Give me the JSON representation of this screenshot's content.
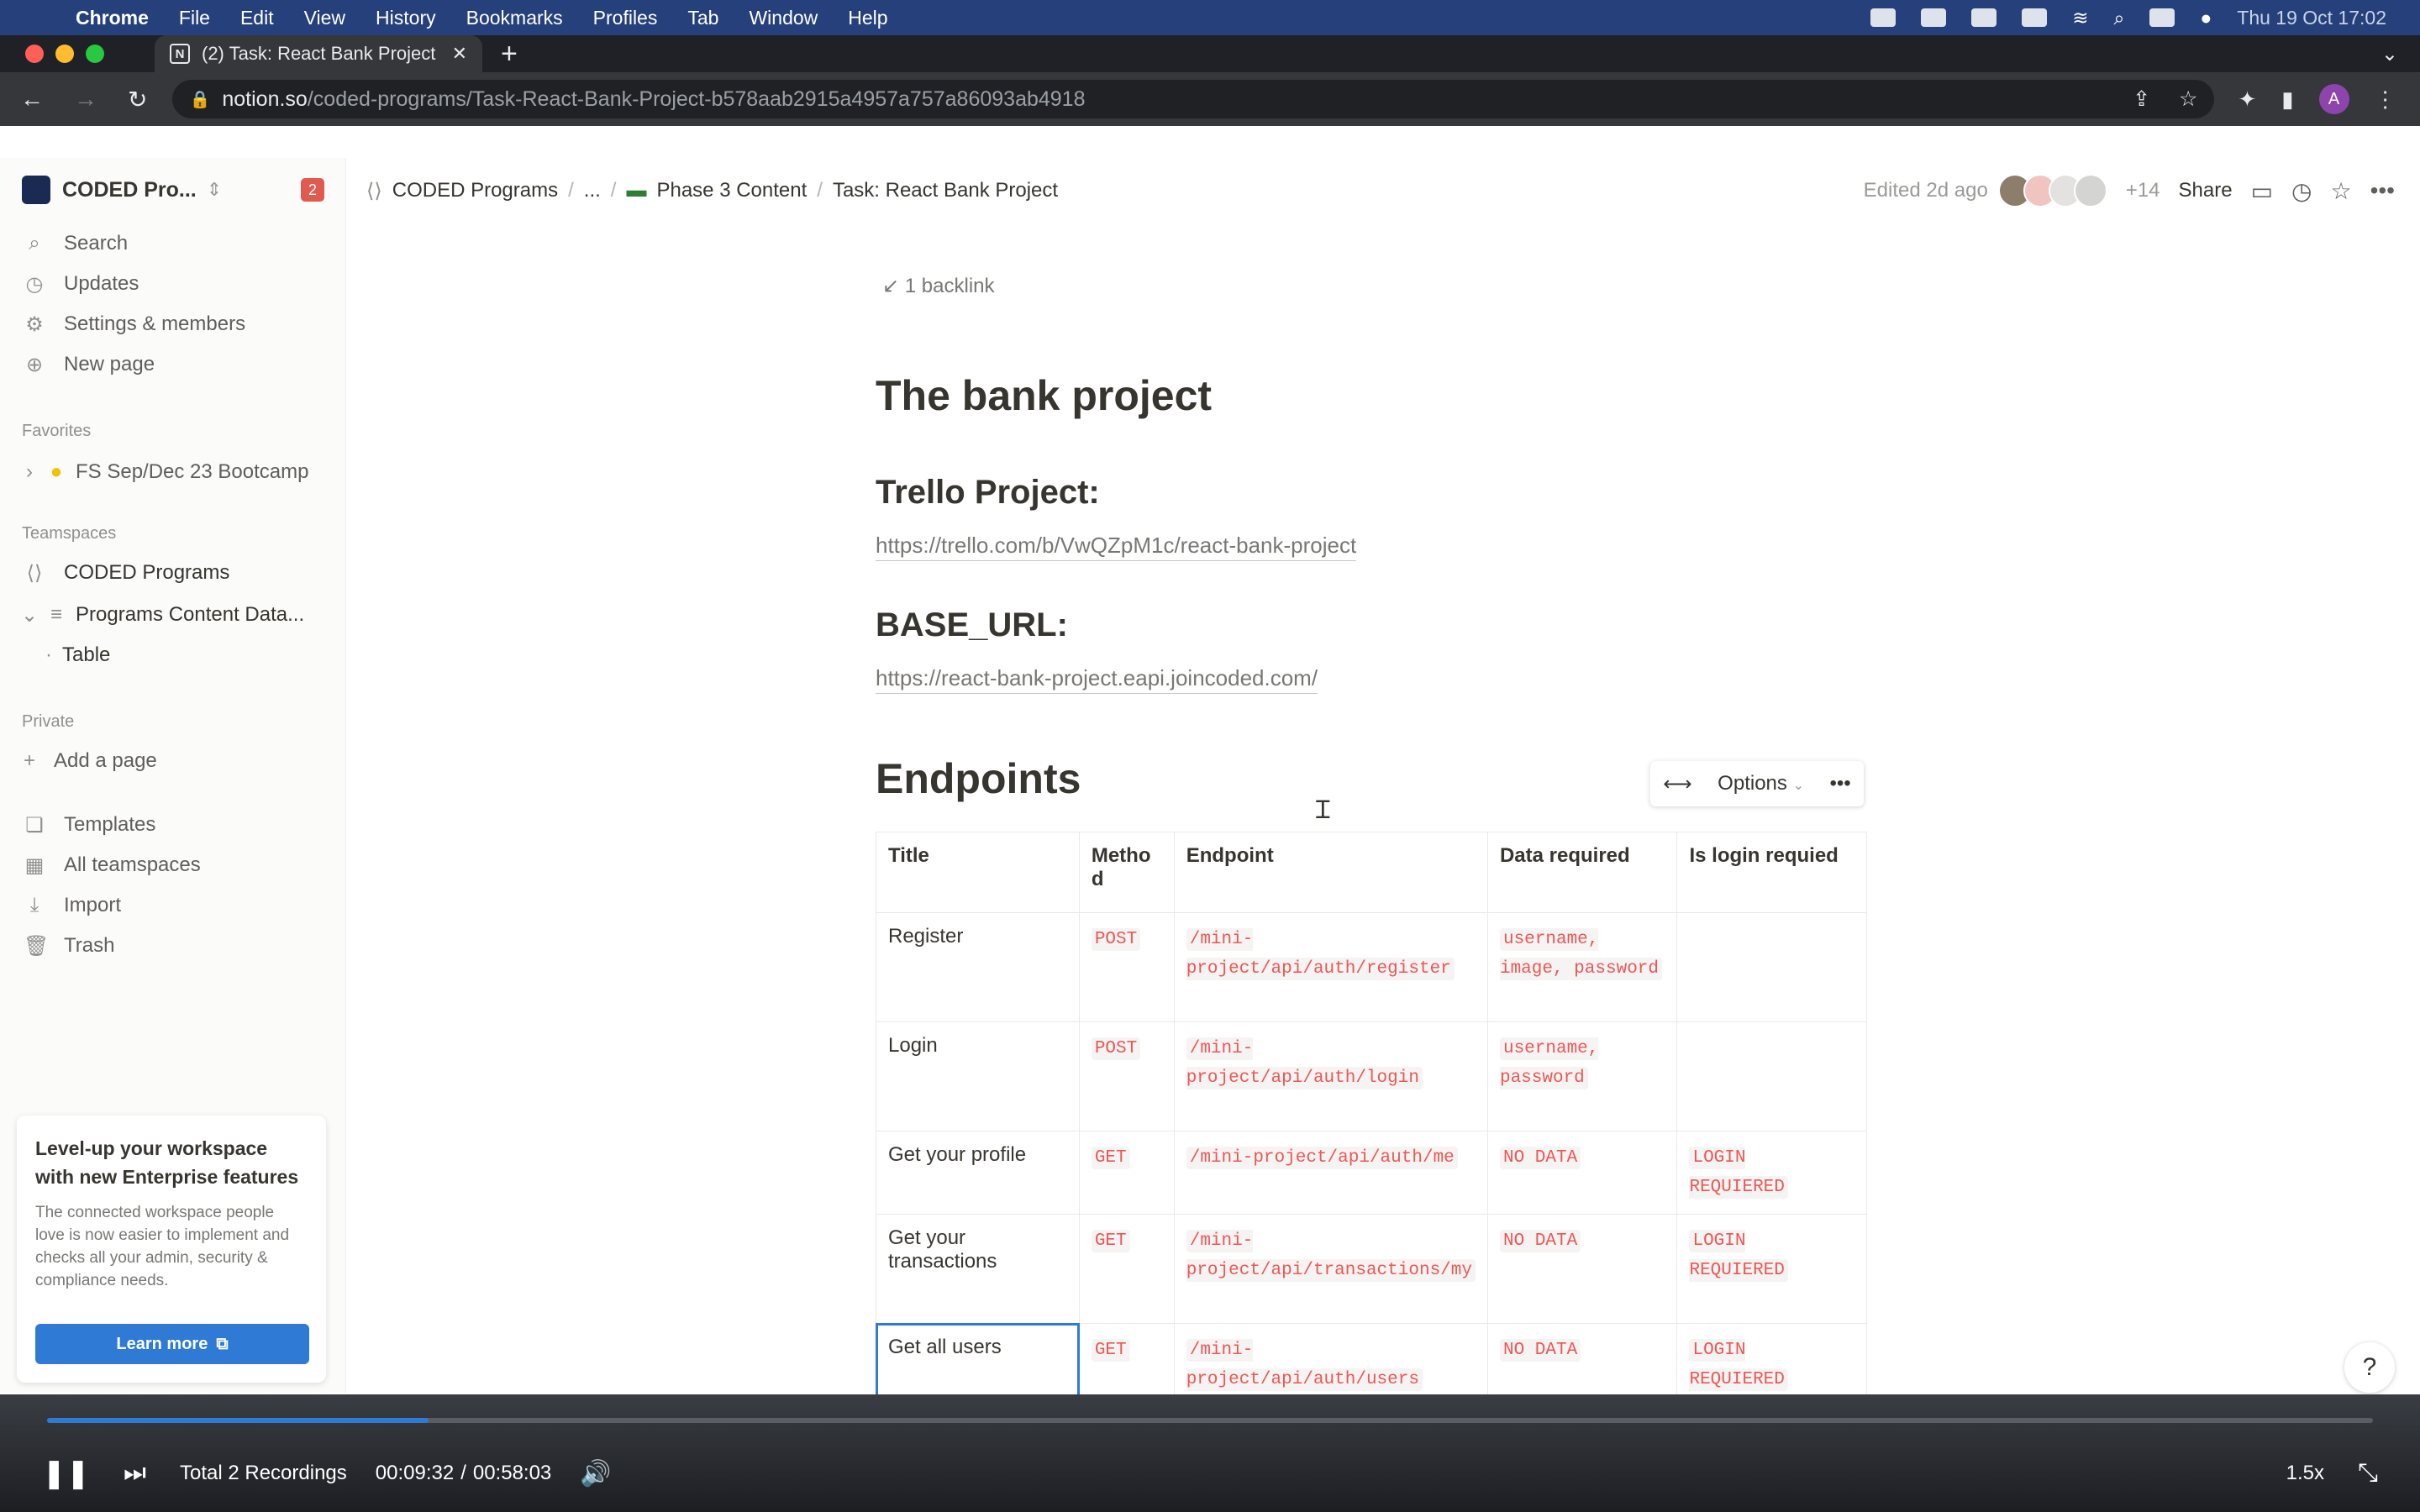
{
  "menubar": {
    "items": [
      "Chrome",
      "File",
      "Edit",
      "View",
      "History",
      "Bookmarks",
      "Profiles",
      "Tab",
      "Window",
      "Help"
    ],
    "datetime": "Thu 19 Oct  17:02"
  },
  "browser": {
    "tab_title": "(2) Task: React Bank Project",
    "url_host": "notion.so",
    "url_path": "/coded-programs/Task-React-Bank-Project-b578aab2915a4957a757a86093ab4918",
    "avatar_letter": "A"
  },
  "sidebar": {
    "workspace_name": "CODED Pro...",
    "badge": "2",
    "top_items": [
      {
        "label": "Search",
        "icon": "search-icon"
      },
      {
        "label": "Updates",
        "icon": "clock-icon"
      },
      {
        "label": "Settings & members",
        "icon": "gear-icon"
      },
      {
        "label": "New page",
        "icon": "plus-circle-icon"
      }
    ],
    "favorites_label": "Favorites",
    "favorites": [
      {
        "label": "FS Sep/Dec 23 Bootcamp"
      }
    ],
    "teamspaces_label": "Teamspaces",
    "teamspaces": [
      {
        "label": "CODED Programs"
      },
      {
        "label": "Programs Content Data..."
      },
      {
        "label": "Table"
      }
    ],
    "private_label": "Private",
    "add_page": "Add a page",
    "bottom_items": [
      {
        "label": "Templates"
      },
      {
        "label": "All teamspaces"
      },
      {
        "label": "Import"
      },
      {
        "label": "Trash"
      }
    ],
    "promo": {
      "title": "Level-up your workspace with new Enterprise features",
      "body": "The connected workspace people love is now easier to implement and checks all your admin, security & compliance needs.",
      "button": "Learn more"
    }
  },
  "topbar": {
    "breadcrumbs": [
      "CODED Programs",
      "...",
      "Phase 3 Content",
      "Task: React Bank Project"
    ],
    "edited": "Edited 2d ago",
    "more_people": "+14",
    "share": "Share"
  },
  "page": {
    "backlink": "1 backlink",
    "title": "The bank project",
    "trello_heading": "Trello Project:",
    "trello_link": "https://trello.com/b/VwQZpM1c/react-bank-project",
    "base_url_heading": "BASE_URL:",
    "base_url_link": "https://react-bank-project.eapi.joincoded.com/",
    "endpoints_heading": "Endpoints",
    "options_label": "Options",
    "table": {
      "headers": [
        "Title",
        "Metho d",
        "Endpoint",
        "Data required",
        "Is login requied"
      ],
      "rows": [
        {
          "title": "Register",
          "method": "POST",
          "endpoint": "/mini-project/api/auth/register",
          "data": "username, image, password",
          "login": ""
        },
        {
          "title": "Login",
          "method": "POST",
          "endpoint": "/mini-project/api/auth/login",
          "data": "username, password",
          "login": ""
        },
        {
          "title": "Get your profile",
          "method": "GET",
          "endpoint": "/mini-project/api/auth/me",
          "data": "NO DATA",
          "login": "LOGIN REQUIERED"
        },
        {
          "title": "Get your transactions",
          "method": "GET",
          "endpoint": "/mini-project/api/transactions/my",
          "data": "NO DATA",
          "login": "LOGIN REQUIERED"
        },
        {
          "title": "Get all users",
          "method": "GET",
          "endpoint": "/mini-project/api/auth/users",
          "data": "NO DATA",
          "login": "LOGIN REQUIERED"
        }
      ]
    }
  },
  "player": {
    "recordings": "Total 2 Recordings",
    "current_time": "00:09:32",
    "separator": "/",
    "total_time": "00:58:03",
    "speed": "1.5x",
    "progress_fraction": 0.164
  },
  "colors": {
    "menubar": "#25407a",
    "accent": "#2f7ad4",
    "code_text": "#eb5757"
  }
}
